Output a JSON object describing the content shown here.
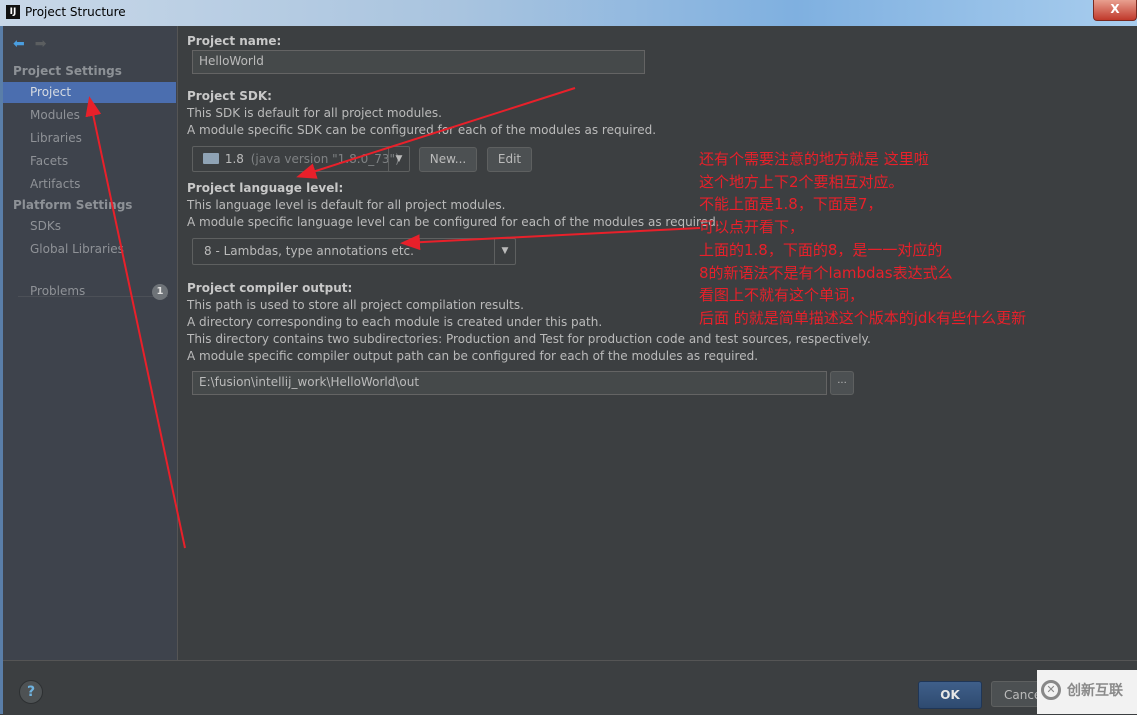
{
  "window": {
    "title": "Project Structure",
    "app_icon": "IJ",
    "close_label": "X"
  },
  "sidebar": {
    "sections": [
      {
        "label": "Project Settings",
        "items": [
          {
            "label": "Project",
            "active": true
          },
          {
            "label": "Modules"
          },
          {
            "label": "Libraries"
          },
          {
            "label": "Facets"
          },
          {
            "label": "Artifacts"
          }
        ]
      },
      {
        "label": "Platform Settings",
        "items": [
          {
            "label": "SDKs"
          },
          {
            "label": "Global Libraries"
          }
        ]
      }
    ],
    "problems": {
      "label": "Problems",
      "count": "1"
    }
  },
  "main": {
    "project_name": {
      "label": "Project name:",
      "value": "HelloWorld"
    },
    "sdk": {
      "label": "Project SDK:",
      "desc1": "This SDK is default for all project modules.",
      "desc2": "A module specific SDK can be configured for each of the modules as required.",
      "selected_version": "1.8",
      "selected_detail": "(java version \"1.8.0_73\")",
      "new_label": "New...",
      "edit_label": "Edit"
    },
    "language_level": {
      "label": "Project language level:",
      "desc1": "This language level is default for all project modules.",
      "desc2": "A module specific language level can be configured for each of the modules as required.",
      "selected": "8 - Lambdas, type annotations etc."
    },
    "compiler_output": {
      "label": "Project compiler output:",
      "desc1": "This path is used to store all project compilation results.",
      "desc2": "A directory corresponding to each module is created under this path.",
      "desc3": "This directory contains two subdirectories: Production and Test for production code and test sources, respectively.",
      "desc4": "A module specific compiler output path can be configured for each of the modules as required.",
      "path": "E:\\fusion\\intellij_work\\HelloWorld\\out",
      "browse_label": "..."
    }
  },
  "footer": {
    "help_label": "?",
    "ok_label": "OK",
    "cancel_label": "Cancel"
  },
  "annotation": {
    "color": "#e8202a",
    "lines": [
      "还有个需要注意的地方就是 这里啦",
      "这个地方上下2个要相互对应。",
      "不能上面是1.8，下面是7，",
      "可以点开看下，",
      "上面的1.8，下面的8，是一一对应的",
      "8的新语法不是有个lambdas表达式么",
      "看图上不就有这个单词，",
      "后面 的就是简单描述这个版本的jdk有些什么更新"
    ]
  },
  "watermark": {
    "text": "创新互联"
  }
}
